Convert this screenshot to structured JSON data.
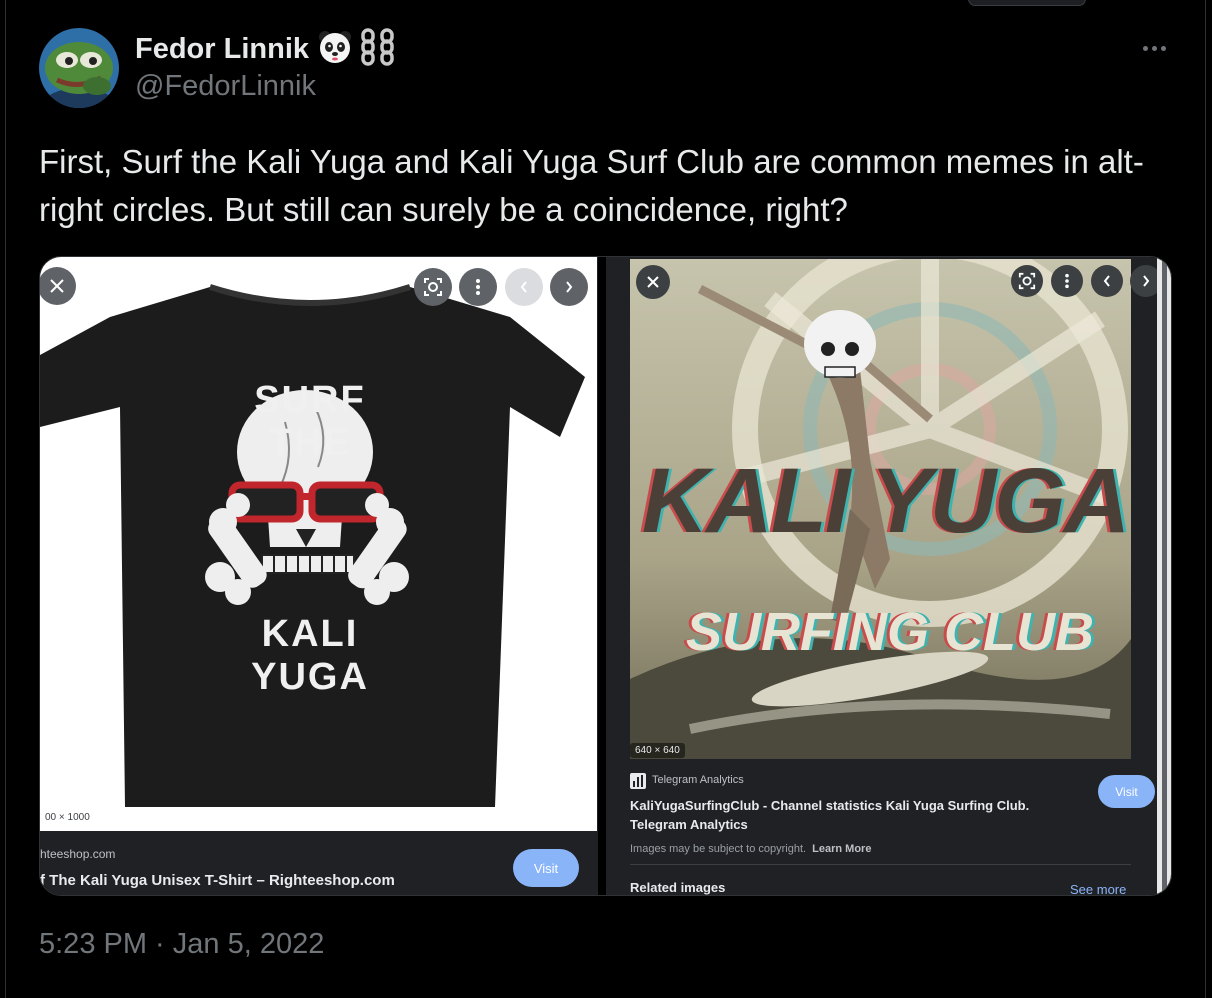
{
  "tweet": {
    "display_name": "Fedor Linnik",
    "handle": "@FedorLinnik",
    "text": "First, Surf the Kali Yuga and Kali Yuga Surf Club are common memes in alt-right circles. But still can surely be a coincidence, right?",
    "timestamp": "5:23 PM · Jan 5, 2022"
  },
  "icons": {
    "name_badges": [
      "panda-emoji-icon",
      "chain-emoji-icon"
    ],
    "more": "more-options-icon"
  },
  "left_result": {
    "shirt_text_top": "SURF THE",
    "shirt_text_bottom": "KALI YUGA",
    "dimensions": "00 × 1000",
    "source": "hteeshop.com",
    "title": "f The Kali Yuga Unisex T-Shirt – Righteeshop.com",
    "visit_label": "Visit"
  },
  "right_result": {
    "poster_text_top": "KALI YUGA",
    "poster_text_bottom": "SURFING CLUB",
    "dimensions": "640 × 640",
    "source": "Telegram Analytics",
    "title_line1": "KaliYugaSurfingClub - Channel statistics Kali Yuga Surfing Club.",
    "title_line2": "Telegram Analytics",
    "copyright": "Images may be subject to copyright.",
    "learn_more": "Learn More",
    "related": "Related images",
    "see_more": "See more",
    "visit_label": "Visit"
  },
  "colors": {
    "background": "#000000",
    "text_primary": "#e7e9ea",
    "text_secondary": "#71767b",
    "google_dark": "#202124",
    "visit_blue": "#8ab4f8",
    "sunglasses_red": "#c0262c"
  }
}
